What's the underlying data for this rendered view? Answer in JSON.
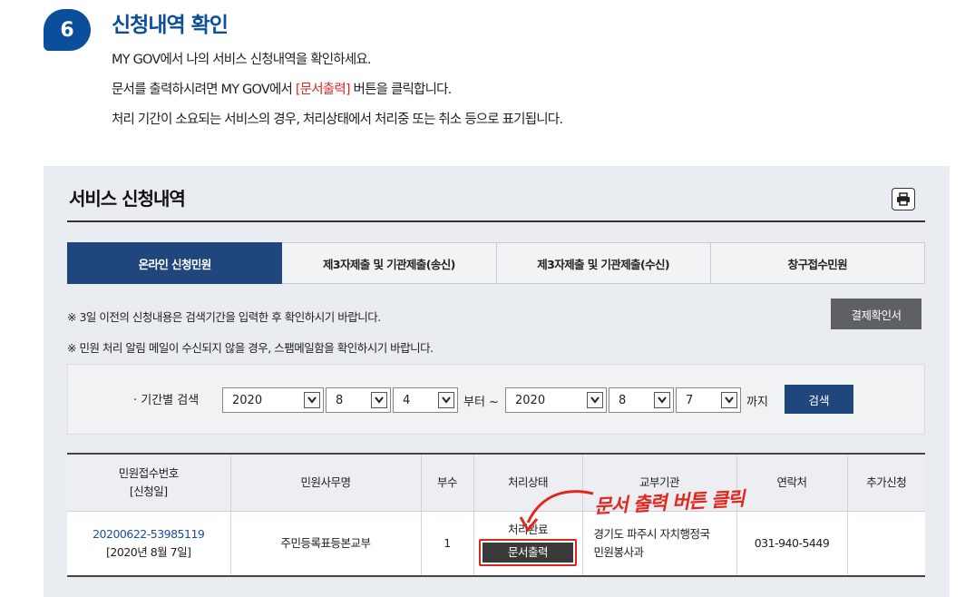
{
  "step": {
    "number": "6",
    "title": "신청내역 확인",
    "desc_line1": "MY GOV에서 나의 서비스 신청내역을 확인하세요.",
    "desc_line2_pre": "문서를 출력하시려면 MY GOV에서 ",
    "desc_line2_hl": "[문서출력]",
    "desc_line2_post": " 버튼을 클릭합니다.",
    "desc_line3": "처리 기간이 소요되는 서비스의 경우, 처리상태에서 처리중 또는 취소 등으로 표기됩니다."
  },
  "panel": {
    "title": "서비스 신청내역",
    "print_icon": "printer-icon"
  },
  "tabs": [
    {
      "label": "온라인 신청민원",
      "active": true
    },
    {
      "label": "제3자제출 및 기관제출(송신)",
      "active": false
    },
    {
      "label": "제3자제출 및 기관제출(수신)",
      "active": false
    },
    {
      "label": "창구접수민원",
      "active": false
    }
  ],
  "notices": {
    "n1": "※ 3일 이전의 신청내용은 검색기간을 입력한 후 확인하시기 바랍니다.",
    "n2": "※ 민원 처리 알림 메일이 수신되지 않을 경우, 스팸메일함을 확인하시기 바랍니다."
  },
  "pay_button": "결제확인서",
  "search": {
    "label": "· 기간별 검색",
    "from_year": "2020",
    "from_month": "8",
    "from_day": "4",
    "from_text": "부터 ~",
    "to_year": "2020",
    "to_month": "8",
    "to_day": "7",
    "to_text": "까지",
    "button": "검색"
  },
  "table": {
    "headers": {
      "h1a": "민원접수번호",
      "h1b": "[신청일]",
      "h2": "민원사무명",
      "h3": "부수",
      "h4": "처리상태",
      "h5": "교부기관",
      "h6": "연락처",
      "h7": "추가신청"
    },
    "row": {
      "receipt_no": "20200622-53985119",
      "apply_date": "[2020년 8월 7일]",
      "service": "주민등록표등본교부",
      "copies": "1",
      "status": "처리완료",
      "doc_button": "문서출력",
      "agency_line1": "경기도 파주시 자치행정국",
      "agency_line2": "민원봉사과",
      "contact": "031-940-5449",
      "extra": ""
    }
  },
  "annotation": "문서 출력 버튼 클릭",
  "colors": {
    "brand": "#0b4f9c",
    "tab_active": "#20467e",
    "highlight": "#e0281f"
  }
}
